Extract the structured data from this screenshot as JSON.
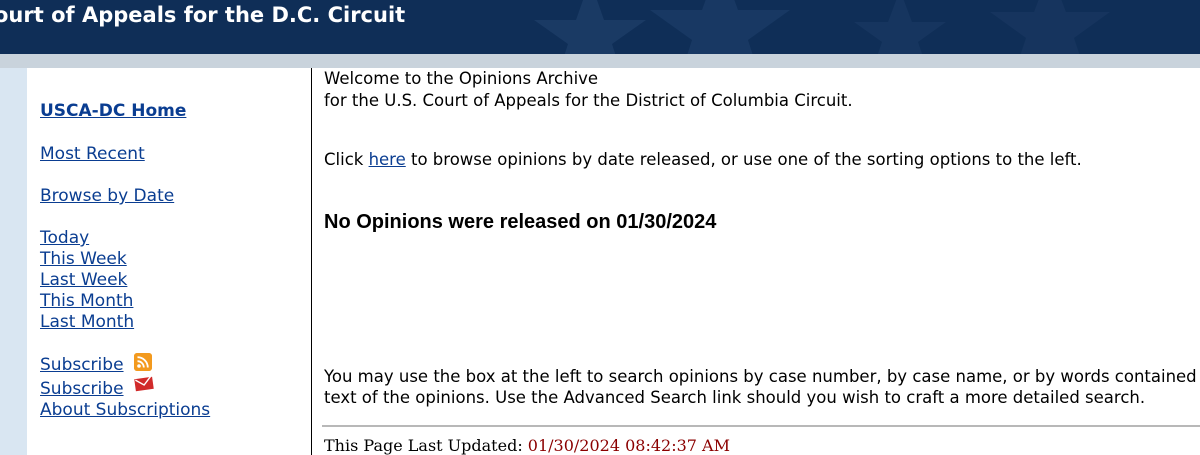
{
  "header": {
    "title": "ourt of Appeals for the D.C. Circuit"
  },
  "colors": {
    "banner": "#0f2e57",
    "link": "#0a3d91",
    "timestamp": "#8b0000",
    "side_strip": "#d9e6f2"
  },
  "nav": {
    "home": "USCA-DC Home",
    "most_recent": "Most Recent",
    "browse_by_date": "Browse by Date",
    "today": "Today",
    "this_week": "This Week",
    "last_week": "Last Week",
    "this_month": "This Month",
    "last_month": "Last Month",
    "subscribe_rss": "Subscribe",
    "subscribe_email": "Subscribe",
    "about_subscriptions": "About Subscriptions",
    "icons": [
      "rss-icon",
      "email-icon"
    ]
  },
  "main": {
    "welcome_line1": "Welcome to the Opinions Archive",
    "welcome_line2": "for the U.S. Court of Appeals for the District of Columbia Circuit.",
    "click_prefix": "Click ",
    "click_link": "here",
    "click_suffix": " to browse opinions by date released, or use one of the sorting options to the left.",
    "no_opinions": "No Opinions were released on 01/30/2024",
    "search_line1": "You may use the box at the left to search opinions by case number, by case name, or by words contained in the",
    "search_line2": "text of the opinions. Use the Advanced Search link should you wish to craft a more detailed search."
  },
  "footer": {
    "updated_label": "This Page Last Updated: ",
    "updated_value": "01/30/2024 08:42:37 AM"
  }
}
